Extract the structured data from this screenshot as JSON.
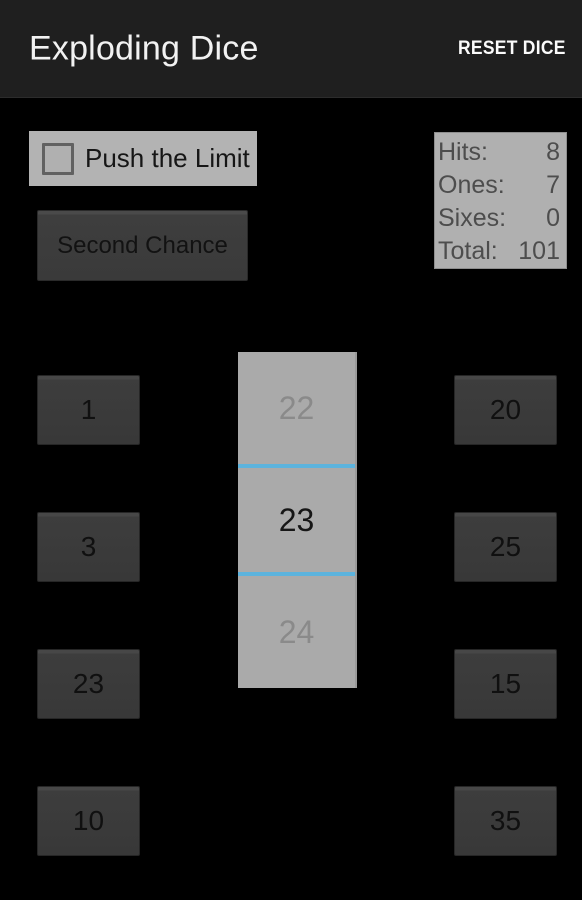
{
  "app": {
    "title": "Exploding Dice",
    "background_color": "#000000",
    "action_bar_color": "#1f1f1f",
    "accent_color": "#5cb3dd"
  },
  "action_bar": {
    "title": "Exploding Dice",
    "reset_button_label": "RESET DICE"
  },
  "options": {
    "push_the_limit": {
      "label": "Push the Limit",
      "checked": false
    },
    "second_chance": {
      "label": "Second Chance"
    }
  },
  "stats": {
    "rows": [
      {
        "label": "Hits:",
        "value": "8"
      },
      {
        "label": "Ones:",
        "value": "7"
      },
      {
        "label": "Sixes:",
        "value": "0"
      },
      {
        "label": "Total:",
        "value": "101"
      }
    ]
  },
  "number_picker": {
    "previous": "22",
    "current": "23",
    "next": "24"
  },
  "dice": {
    "left_column": [
      "1",
      "3",
      "23",
      "10"
    ],
    "right_column": [
      "20",
      "25",
      "15",
      "35"
    ]
  }
}
